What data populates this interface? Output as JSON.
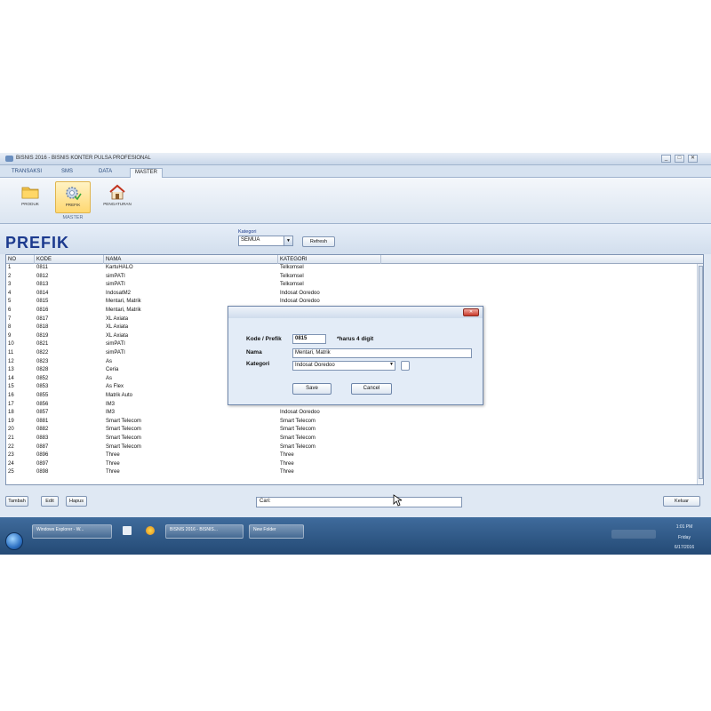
{
  "window": {
    "title": "BISNIS 2016 - BISNIS KONTER PULSA PROFESIONAL",
    "controls": [
      "_",
      "□",
      "✕"
    ]
  },
  "tabs": [
    {
      "label": "TRANSAKSI"
    },
    {
      "label": "SMS"
    },
    {
      "label": "DATA"
    },
    {
      "label": "MASTER",
      "active": true
    }
  ],
  "ribbon": {
    "buttons": [
      {
        "label": "PRODUK",
        "icon": "folder-icon"
      },
      {
        "label": "PREFIK",
        "icon": "gear-icon",
        "active": true
      },
      {
        "label": "PENGATURAN",
        "icon": "home-icon"
      }
    ],
    "group_label": "MASTER"
  },
  "header": {
    "title": "PREFIK",
    "kategori_label": "Kategori",
    "kategori_value": "SEMUA",
    "refresh_label": "Refresh"
  },
  "table": {
    "columns": [
      "NO",
      "KODE",
      "NAMA",
      "KATEGORI"
    ],
    "rows": [
      [
        "1",
        "0811",
        "KartuHALO",
        "Telkomsel"
      ],
      [
        "2",
        "0812",
        "simPATI",
        "Telkomsel"
      ],
      [
        "3",
        "0813",
        "simPATI",
        "Telkomsel"
      ],
      [
        "4",
        "0814",
        "IndosatM2",
        "Indosat Ooredoo"
      ],
      [
        "5",
        "0815",
        "Mentari, Matrik",
        "Indosat Ooredoo"
      ],
      [
        "6",
        "0816",
        "Mentari, Matrik",
        ""
      ],
      [
        "7",
        "0817",
        "XL Axiata",
        ""
      ],
      [
        "8",
        "0818",
        "XL Axiata",
        ""
      ],
      [
        "9",
        "0819",
        "XL Axiata",
        ""
      ],
      [
        "10",
        "0821",
        "simPATI",
        ""
      ],
      [
        "11",
        "0822",
        "simPATI",
        ""
      ],
      [
        "12",
        "0823",
        "As",
        ""
      ],
      [
        "13",
        "0828",
        "Ceria",
        ""
      ],
      [
        "14",
        "0852",
        "As",
        ""
      ],
      [
        "15",
        "0853",
        "As Flex",
        ""
      ],
      [
        "16",
        "0855",
        "Matrik Auto",
        ""
      ],
      [
        "17",
        "0856",
        "IM3",
        "Indosat Ooredoo"
      ],
      [
        "18",
        "0857",
        "IM3",
        "Indosat Ooredoo"
      ],
      [
        "19",
        "0881",
        "Smart Telecom",
        "Smart Telecom"
      ],
      [
        "20",
        "0882",
        "Smart Telecom",
        "Smart Telecom"
      ],
      [
        "21",
        "0883",
        "Smart Telecom",
        "Smart Telecom"
      ],
      [
        "22",
        "0887",
        "Smart Telecom",
        "Smart Telecom"
      ],
      [
        "23",
        "0896",
        "Three",
        "Three"
      ],
      [
        "24",
        "0897",
        "Three",
        "Three"
      ],
      [
        "25",
        "0898",
        "Three",
        "Three"
      ]
    ]
  },
  "footer": {
    "tambah_label": "Tambah",
    "edit_label": "Edit",
    "hapus_label": "Hapus",
    "cari_value": "Cari:",
    "keluar_label": "Keluar"
  },
  "dialog": {
    "close_label": "✕",
    "kode_label": "Kode / Prefik",
    "kode_value": "0815",
    "kode_hint": "*harus 4 digit",
    "nama_label": "Nama",
    "nama_value": "Mentari, Matrik",
    "kategori_label": "Kategori",
    "kategori_value": "Indosat Ooredoo",
    "save_label": "Save",
    "cancel_label": "Cancel"
  },
  "taskbar": {
    "items": [
      "Windows Explorer - W...",
      "BISNIS 2016 - BISNIS...",
      "New Folder"
    ],
    "time": "1:01 PM",
    "day": "Friday",
    "date": "6/17/2016"
  },
  "colors": {
    "title_blue": "#1c3a8e",
    "ribbon_active": "#ffd871",
    "taskbar": "#2f5a8a"
  }
}
